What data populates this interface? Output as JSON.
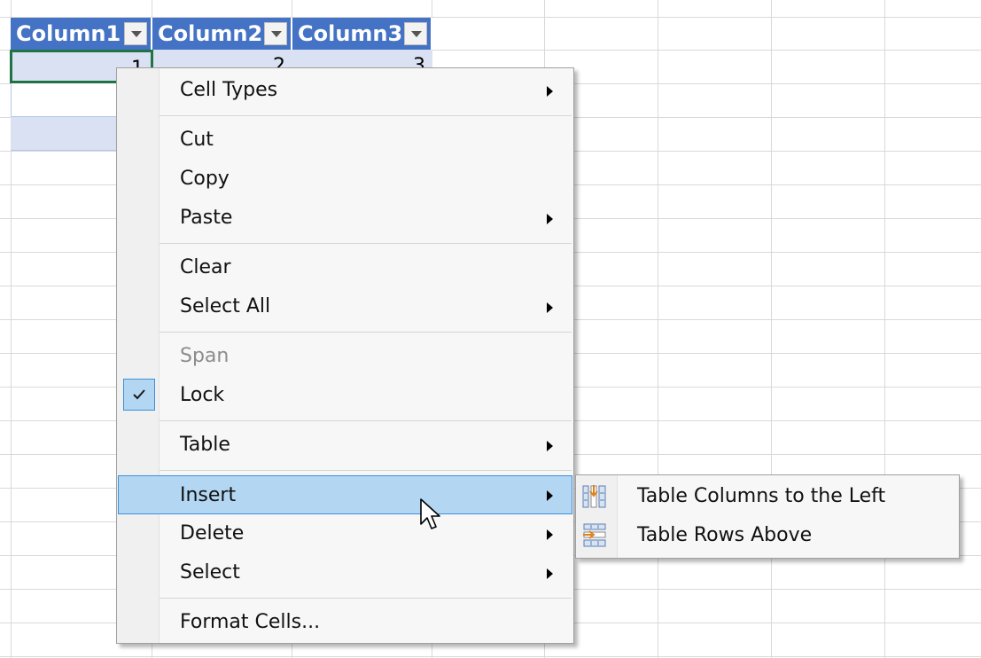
{
  "table": {
    "headers": [
      "Column1",
      "Column2",
      "Column3"
    ],
    "row1": [
      "1",
      "2",
      "3"
    ]
  },
  "menu": {
    "cell_types": "Cell Types",
    "cut": "Cut",
    "copy": "Copy",
    "paste": "Paste",
    "clear": "Clear",
    "select_all": "Select All",
    "span": "Span",
    "lock": "Lock",
    "table": "Table",
    "insert": "Insert",
    "delete": "Delete",
    "select": "Select",
    "format_cells": "Format Cells..."
  },
  "submenu": {
    "columns_left": "Table Columns to the Left",
    "rows_above": "Table Rows Above"
  },
  "icons": {
    "filter": "chevron-down-icon",
    "check": "check-icon",
    "submenu_arrow": "chevron-right-icon",
    "insert_columns": "insert-columns-left-icon",
    "insert_rows": "insert-rows-above-icon",
    "cursor": "mouse-pointer-icon"
  },
  "colors": {
    "table_header": "#4472c4",
    "table_band": "#d9e1f2",
    "active_cell_border": "#217346",
    "menu_highlight": "#b3d7f3",
    "menu_highlight_border": "#3c8fd9"
  }
}
